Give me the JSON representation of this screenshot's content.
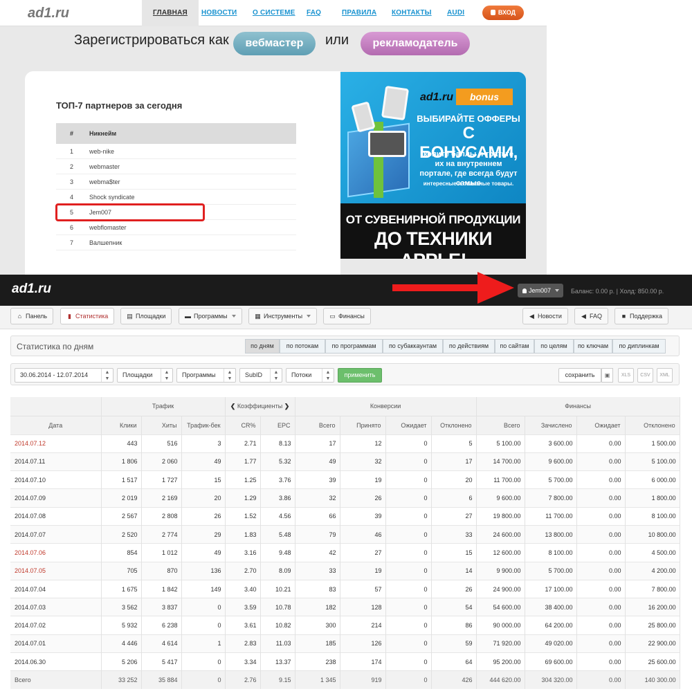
{
  "landing": {
    "logo": "ad1.ru",
    "nav": [
      {
        "label": "ГЛАВНАЯ",
        "active": true
      },
      {
        "label": "НОВОСТИ"
      },
      {
        "label": "О СИСТЕМЕ"
      },
      {
        "label": "FAQ"
      },
      {
        "label": "ПРАВИЛА"
      },
      {
        "label": "КОНТАКТЫ"
      },
      {
        "label": "AUDI"
      }
    ],
    "login_label": "ВХОД",
    "register_prefix": "Зарегистрироваться как",
    "register_webmaster": "вебмастер",
    "register_or": "или",
    "register_advertiser": "рекламодатель",
    "top_title": "ТОП-7 партнеров за сегодня",
    "top_headers": {
      "num": "#",
      "nick": "Никнейм"
    },
    "top_rows": [
      {
        "num": "1",
        "nick": "web-nike"
      },
      {
        "num": "2",
        "nick": "webmaster"
      },
      {
        "num": "3",
        "nick": "webma$ter"
      },
      {
        "num": "4",
        "nick": "Shock syndicate"
      },
      {
        "num": "5",
        "nick": "Jem007"
      },
      {
        "num": "6",
        "nick": "webflomaster"
      },
      {
        "num": "7",
        "nick": "Валшепник"
      }
    ],
    "banner": {
      "logo": "ad1.ru",
      "bonus": "bonus",
      "line1": "ВЫБИРАЙТЕ ОФФЕРЫ",
      "line2": "С БОНУСАМИ,",
      "line3": "копите баллы и тратьте их на внутреннем портале, где всегда будут самые",
      "line4": "интересные и полезные товары.",
      "lower1": "ОТ СУВЕНИРНОЙ ПРОДУКЦИИ",
      "lower2": "ДО ТЕХНИКИ APPLE!"
    }
  },
  "dashboard": {
    "logo": "ad1.ru",
    "user": "Jem007",
    "balance_text": "Баланс: 0.00 р. | Холд: 850.00 р.",
    "tabs_left": [
      {
        "label": "Панель",
        "icon": "home-icon"
      },
      {
        "label": "Статистика",
        "icon": "bar-chart-icon",
        "active": true
      },
      {
        "label": "Площадки",
        "icon": "document-icon"
      },
      {
        "label": "Программы",
        "icon": "list-icon",
        "dropdown": true
      },
      {
        "label": "Инструменты",
        "icon": "grid-icon",
        "dropdown": true
      },
      {
        "label": "Финансы",
        "icon": "money-icon"
      }
    ],
    "tabs_right": [
      {
        "label": "Новости",
        "icon": "megaphone-icon"
      },
      {
        "label": "FAQ",
        "icon": "megaphone-icon"
      },
      {
        "label": "Поддержка",
        "icon": "chat-icon"
      }
    ],
    "stat_title": "Статистика по дням",
    "segments": [
      "по дням",
      "по потокам",
      "по программам",
      "по субаккаунтам",
      "по действиям",
      "по сайтам",
      "по целям",
      "по ключам",
      "по диплинкам"
    ],
    "filters": {
      "date_range": "30.06.2014 - 12.07.2014",
      "sites": "Площадки",
      "programs": "Программы",
      "subid": "SubID",
      "streams": "Потоки",
      "apply": "применить",
      "save": "сохранить",
      "exports": [
        "XLS",
        "CSV",
        "XML"
      ]
    },
    "table": {
      "groups": {
        "traffic": "Трафик",
        "coef": "Коэффициенты",
        "conv": "Конверсии",
        "fin": "Финансы"
      },
      "columns": [
        "Дата",
        "Клики",
        "Хиты",
        "Трафик-бек",
        "CR%",
        "EPC",
        "Всего",
        "Принято",
        "Ожидает",
        "Отклонено",
        "Всего",
        "Зачислено",
        "Ожидает",
        "Отклонено"
      ],
      "rows": [
        [
          "2014.07.12",
          "443",
          "516",
          "3",
          "2.71",
          "8.13",
          "17",
          "12",
          "0",
          "5",
          "5 100.00",
          "3 600.00",
          "0.00",
          "1 500.00"
        ],
        [
          "2014.07.11",
          "1 806",
          "2 060",
          "49",
          "1.77",
          "5.32",
          "49",
          "32",
          "0",
          "17",
          "14 700.00",
          "9 600.00",
          "0.00",
          "5 100.00"
        ],
        [
          "2014.07.10",
          "1 517",
          "1 727",
          "15",
          "1.25",
          "3.76",
          "39",
          "19",
          "0",
          "20",
          "11 700.00",
          "5 700.00",
          "0.00",
          "6 000.00"
        ],
        [
          "2014.07.09",
          "2 019",
          "2 169",
          "20",
          "1.29",
          "3.86",
          "32",
          "26",
          "0",
          "6",
          "9 600.00",
          "7 800.00",
          "0.00",
          "1 800.00"
        ],
        [
          "2014.07.08",
          "2 567",
          "2 808",
          "26",
          "1.52",
          "4.56",
          "66",
          "39",
          "0",
          "27",
          "19 800.00",
          "11 700.00",
          "0.00",
          "8 100.00"
        ],
        [
          "2014.07.07",
          "2 520",
          "2 774",
          "29",
          "1.83",
          "5.48",
          "79",
          "46",
          "0",
          "33",
          "24 600.00",
          "13 800.00",
          "0.00",
          "10 800.00"
        ],
        [
          "2014.07.06",
          "854",
          "1 012",
          "49",
          "3.16",
          "9.48",
          "42",
          "27",
          "0",
          "15",
          "12 600.00",
          "8 100.00",
          "0.00",
          "4 500.00"
        ],
        [
          "2014.07.05",
          "705",
          "870",
          "136",
          "2.70",
          "8.09",
          "33",
          "19",
          "0",
          "14",
          "9 900.00",
          "5 700.00",
          "0.00",
          "4 200.00"
        ],
        [
          "2014.07.04",
          "1 675",
          "1 842",
          "149",
          "3.40",
          "10.21",
          "83",
          "57",
          "0",
          "26",
          "24 900.00",
          "17 100.00",
          "0.00",
          "7 800.00"
        ],
        [
          "2014.07.03",
          "3 562",
          "3 837",
          "0",
          "3.59",
          "10.78",
          "182",
          "128",
          "0",
          "54",
          "54 600.00",
          "38 400.00",
          "0.00",
          "16 200.00"
        ],
        [
          "2014.07.02",
          "5 932",
          "6 238",
          "0",
          "3.61",
          "10.82",
          "300",
          "214",
          "0",
          "86",
          "90 000.00",
          "64 200.00",
          "0.00",
          "25 800.00"
        ],
        [
          "2014.07.01",
          "4 446",
          "4 614",
          "1",
          "2.83",
          "11.03",
          "185",
          "126",
          "0",
          "59",
          "71 920.00",
          "49 020.00",
          "0.00",
          "22 900.00"
        ],
        [
          "2014.06.30",
          "5 206",
          "5 417",
          "0",
          "3.34",
          "13.37",
          "238",
          "174",
          "0",
          "64",
          "95 200.00",
          "69 600.00",
          "0.00",
          "25 600.00"
        ]
      ],
      "weekend_rows": [
        0,
        6,
        7
      ],
      "total": [
        "Всего",
        "33 252",
        "35 884",
        "0",
        "2.76",
        "9.15",
        "1 345",
        "919",
        "0",
        "426",
        "444 620.00",
        "304 320.00",
        "0.00",
        "140 300.00"
      ]
    }
  },
  "colors": {
    "link": "#1a93d0",
    "login": "#e0622a",
    "highlight": "#e02020",
    "weekend": "#c0392b",
    "apply": "#6cbf6c"
  }
}
